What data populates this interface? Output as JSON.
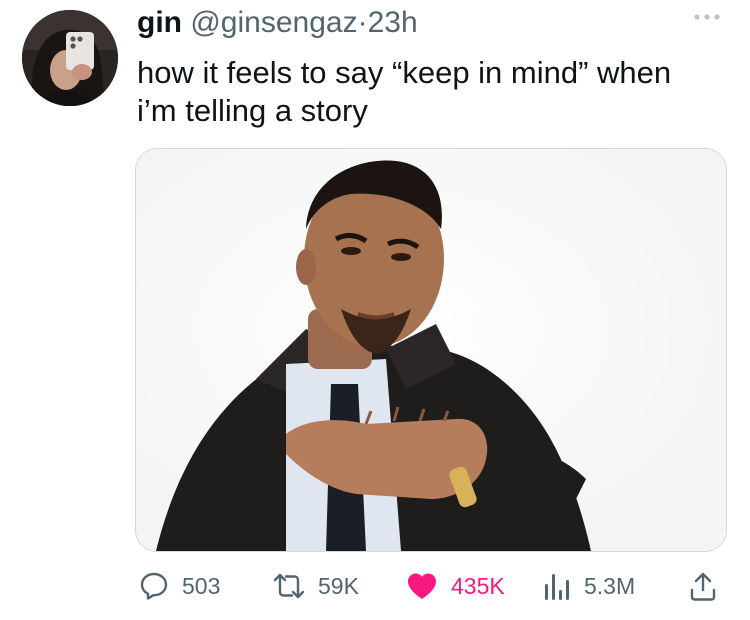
{
  "tweet": {
    "author": {
      "name": "gin",
      "handle": "@ginsengaz",
      "separator": "·",
      "time": "23h"
    },
    "text_lines": [
      "how it feels to say “keep in mind” when",
      "i’m telling a story"
    ],
    "media": {
      "type": "photo"
    },
    "actions": {
      "replies": {
        "icon": "reply-icon",
        "count": "503"
      },
      "retweets": {
        "icon": "retweet-icon",
        "count": "59K"
      },
      "likes": {
        "icon": "heart-filled-icon",
        "count": "435K",
        "liked": true
      },
      "views": {
        "icon": "analytics-icon",
        "count": "5.3M"
      },
      "share": {
        "icon": "share-icon"
      }
    }
  },
  "colors": {
    "text_primary": "#0f1419",
    "text_secondary": "#536471",
    "like_active": "#f91880",
    "border": "#cfd9de"
  }
}
